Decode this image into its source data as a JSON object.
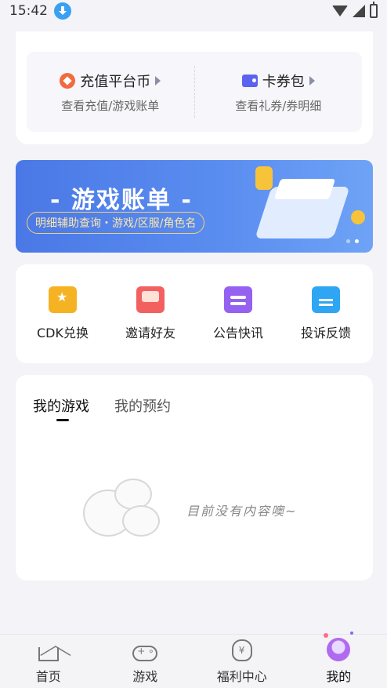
{
  "status_bar": {
    "time": "15:42",
    "download_icon": "download-icon",
    "wifi_icon": "wifi-icon",
    "signal_icon": "signal-icon",
    "battery_icon": "battery-icon"
  },
  "wallet": {
    "recharge": {
      "icon": "platform-coin-icon",
      "title": "充值平台币",
      "subtitle": "查看充值/游戏账单"
    },
    "coupon": {
      "icon": "coupon-wallet-icon",
      "title": "卡券包",
      "subtitle": "查看礼券/券明细"
    }
  },
  "banner": {
    "title": "- 游戏账单 -",
    "subtitle": "明细辅助查询・游戏/区服/角色名",
    "slides": 2,
    "active_slide": 2
  },
  "tools": [
    {
      "label": "CDK兑换",
      "icon": "cdk-ticket-icon"
    },
    {
      "label": "邀请好友",
      "icon": "invite-envelope-icon"
    },
    {
      "label": "公告快讯",
      "icon": "notice-icon"
    },
    {
      "label": "投诉反馈",
      "icon": "report-document-icon"
    }
  ],
  "my_games": {
    "tabs": [
      {
        "label": "我的游戏",
        "active": true
      },
      {
        "label": "我的预约",
        "active": false
      }
    ],
    "empty_text": "目前没有内容噢~"
  },
  "bottom_nav": [
    {
      "label": "首页",
      "icon": "home-icon",
      "active": false
    },
    {
      "label": "游戏",
      "icon": "gamepad-icon",
      "active": false
    },
    {
      "label": "福利中心",
      "icon": "money-bag-icon",
      "active": false
    },
    {
      "label": "我的",
      "icon": "profile-avatar-icon",
      "active": true
    }
  ],
  "colors": {
    "page_bg": "#f3f3f8",
    "banner_blue": "#4a78e6",
    "coin_orange": "#f26a3d",
    "wallet_purple": "#5b63f0",
    "cdk_gold": "#f5b324",
    "invite_red": "#f26060",
    "notice_purple": "#9461f0",
    "report_blue": "#2ea6f3"
  }
}
